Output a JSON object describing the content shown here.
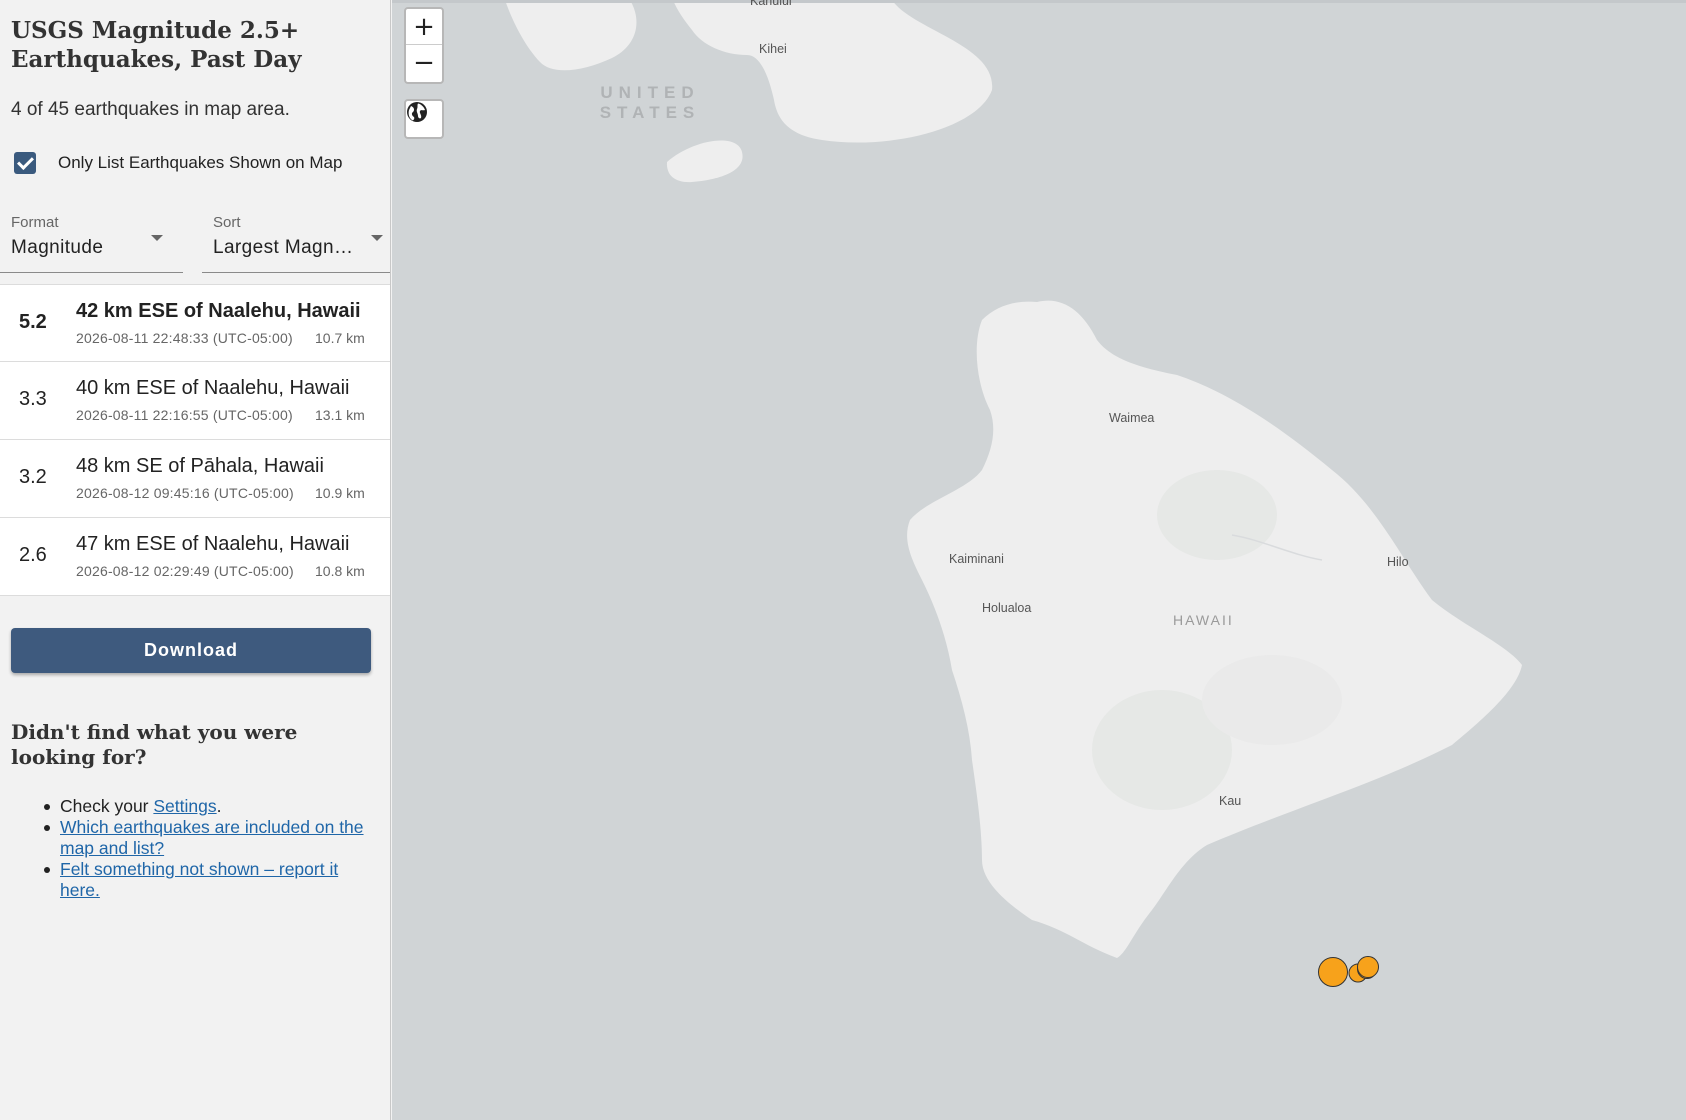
{
  "panel": {
    "title": "USGS Magnitude 2.5+ Earthquakes, Past Day",
    "count_text": "4 of 45 earthquakes in map area.",
    "only_list_label": "Only List Earthquakes Shown on Map",
    "only_list_checked": true,
    "format": {
      "label": "Format",
      "value": "Magnitude"
    },
    "sort": {
      "label": "Sort",
      "value": "Largest Magnitude First"
    },
    "download_label": "Download",
    "help": {
      "title": "Didn't find what you were looking for?",
      "item1_prefix": "Check your ",
      "item1_link": "Settings",
      "item1_suffix": ".",
      "item2_link": "Which earthquakes are included on the map and list?",
      "item3_link": "Felt something not shown – report it here."
    }
  },
  "earthquakes": [
    {
      "mag": "5.2",
      "place": "42 km ESE of Naalehu, Hawaii",
      "time": "2026-08-11 22:48:33 (UTC-05:00)",
      "depth": "10.7 km",
      "bold": true
    },
    {
      "mag": "3.3",
      "place": "40 km ESE of Naalehu, Hawaii",
      "time": "2026-08-11 22:16:55 (UTC-05:00)",
      "depth": "13.1 km",
      "bold": false
    },
    {
      "mag": "3.2",
      "place": "48 km SE of Pāhala, Hawaii",
      "time": "2026-08-12 09:45:16 (UTC-05:00)",
      "depth": "10.9 km",
      "bold": false
    },
    {
      "mag": "2.6",
      "place": "47 km ESE of Naalehu, Hawaii",
      "time": "2026-08-12 02:29:49 (UTC-05:00)",
      "depth": "10.8 km",
      "bold": false
    }
  ],
  "map": {
    "zoom_in": "+",
    "zoom_out": "−",
    "country_line1": "UNITED",
    "country_line2": "STATES",
    "places": {
      "kihei": "Kihei",
      "kahului": "Kahului",
      "waimea": "Waimea",
      "kaiminani": "Kaiminani",
      "holualoa": "Holualoa",
      "hilo": "Hilo",
      "hawaii": "HAWAII",
      "kau": "Kau"
    },
    "colors": {
      "ocean": "#d0d4d6",
      "land": "#eeeeee",
      "marker_fill": "#f7a21b",
      "button": "#3e5a7e",
      "link": "#1f66a8"
    }
  }
}
